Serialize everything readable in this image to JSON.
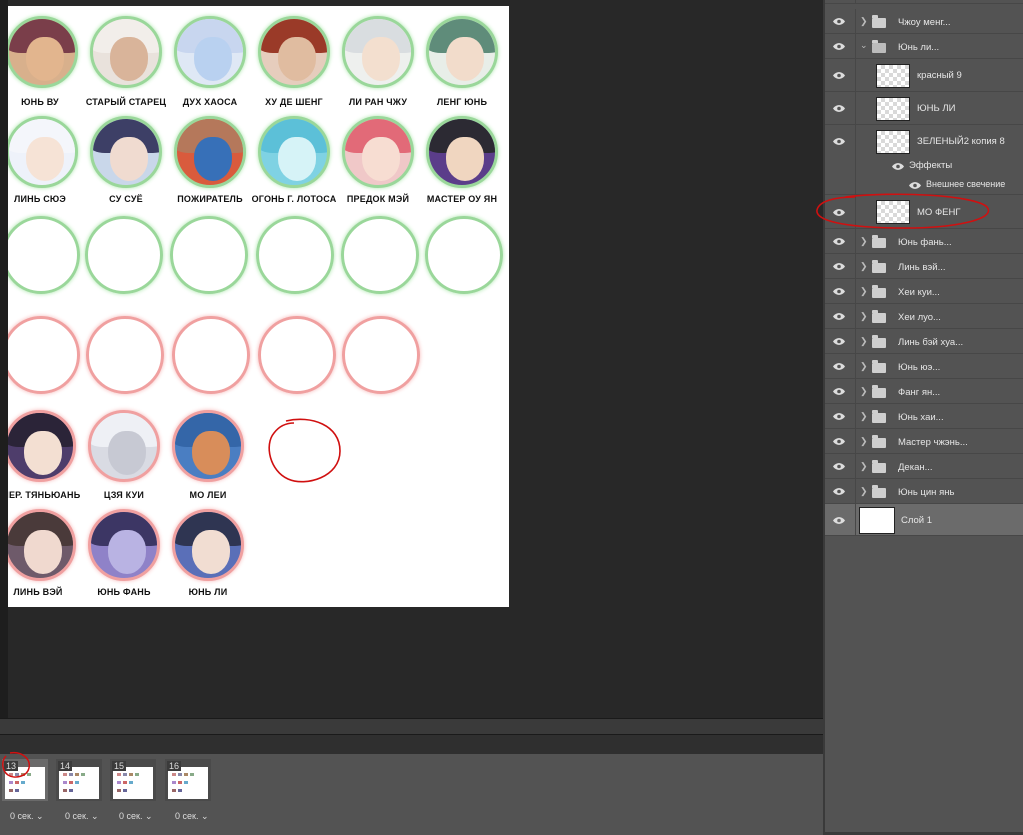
{
  "document": {
    "row1": [
      "ЮНЬ ВУ",
      "СТАРЫЙ СТАРЕЦ",
      "ДУХ ХАОСА",
      "ХУ ДЕ ШЕНГ",
      "ЛИ РАН ЧЖУ",
      "ЛЕНГ ЮНЬ"
    ],
    "row2": [
      "ЛИНЬ СЮЭ",
      "СУ СУЁ",
      "ПОЖИРАТЕЛЬ",
      "ОГОНЬ Г. ЛОТОСА",
      "ПРЕДОК МЭЙ",
      "МАСТЕР ОУ ЯН"
    ],
    "row5": [
      "ИПЕР. ТЯНЬЮАНЬ",
      "ЦЗЯ КУИ",
      "МО ЛЕИ"
    ],
    "row6": [
      "ЛИНЬ ВЭЙ",
      "ЮНЬ ФАНЬ",
      "ЮНЬ ЛИ"
    ]
  },
  "layers": [
    {
      "type": "folder",
      "name": "Чжоу менг...",
      "expanded": false
    },
    {
      "type": "folder",
      "name": "Юнь ли...",
      "expanded": true
    },
    {
      "type": "layer",
      "name": "красный 9"
    },
    {
      "type": "layer",
      "name": "ЮНЬ ЛИ"
    },
    {
      "type": "layer",
      "name": "ЗЕЛЕНЫЙ2 копия 8"
    },
    {
      "type": "effects",
      "name": "Эффекты"
    },
    {
      "type": "effect",
      "name": "Внешнее свечение"
    },
    {
      "type": "layer",
      "name": "МО ФЕНГ"
    },
    {
      "type": "folder",
      "name": "Юнь фань..."
    },
    {
      "type": "folder",
      "name": "Линь вэй..."
    },
    {
      "type": "folder",
      "name": "Хеи куи..."
    },
    {
      "type": "folder",
      "name": "Хеи луо..."
    },
    {
      "type": "folder",
      "name": "Линь бэй хуа..."
    },
    {
      "type": "folder",
      "name": "Юнь юэ..."
    },
    {
      "type": "folder",
      "name": "Фанг ян..."
    },
    {
      "type": "folder",
      "name": "Юнь хаи..."
    },
    {
      "type": "folder",
      "name": "Мастер чжэнь..."
    },
    {
      "type": "folder",
      "name": "Декан..."
    },
    {
      "type": "folder",
      "name": "Юнь цин янь"
    },
    {
      "type": "layer",
      "name": "Слой 1",
      "selected": true
    }
  ],
  "timeline": {
    "frames": [
      {
        "number": "13",
        "delay": "0 сек.",
        "selected": true
      },
      {
        "number": "14",
        "delay": "0 сек."
      },
      {
        "number": "15",
        "delay": "0 сек."
      },
      {
        "number": "16",
        "delay": "0 сек."
      }
    ]
  },
  "colors": {
    "green_ring": "#9ad79a",
    "red_ring": "#f0a0a0",
    "annotation": "#d01010",
    "panel": "#535353",
    "selected_row": "#6b6b6b"
  }
}
